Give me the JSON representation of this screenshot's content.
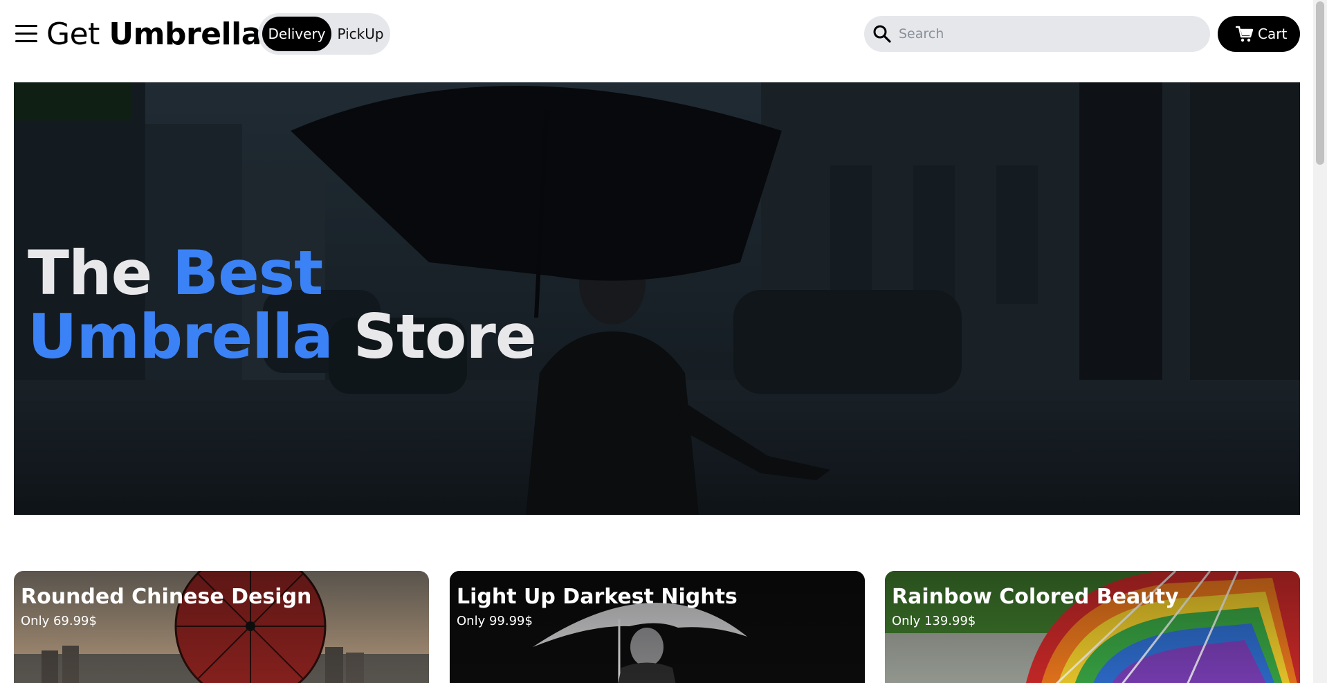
{
  "header": {
    "brand_light": "Get",
    "brand_bold": "Umbrellas",
    "fulfillment": {
      "options": [
        "Delivery",
        "PickUp"
      ],
      "selected": "Delivery"
    },
    "search": {
      "placeholder": "Search",
      "value": "",
      "icon": "search-icon"
    },
    "cart": {
      "label": "Cart",
      "icon": "cart-icon"
    },
    "menu_icon": "hamburger-menu-icon"
  },
  "hero": {
    "line1_plain": "The ",
    "line1_accent": "Best",
    "line2_accent": "Umbrella",
    "line2_plain": " Store",
    "accent_color": "#3b82f6"
  },
  "products": [
    {
      "title": "Rounded Chinese Design",
      "price": "Only 69.99$"
    },
    {
      "title": "Light Up Darkest Nights",
      "price": "Only 99.99$"
    },
    {
      "title": "Rainbow Colored Beauty",
      "price": "Only 139.99$"
    }
  ],
  "colors": {
    "primary": "#000000",
    "toggle_bg": "#e5e7eb",
    "accent": "#3b82f6"
  }
}
